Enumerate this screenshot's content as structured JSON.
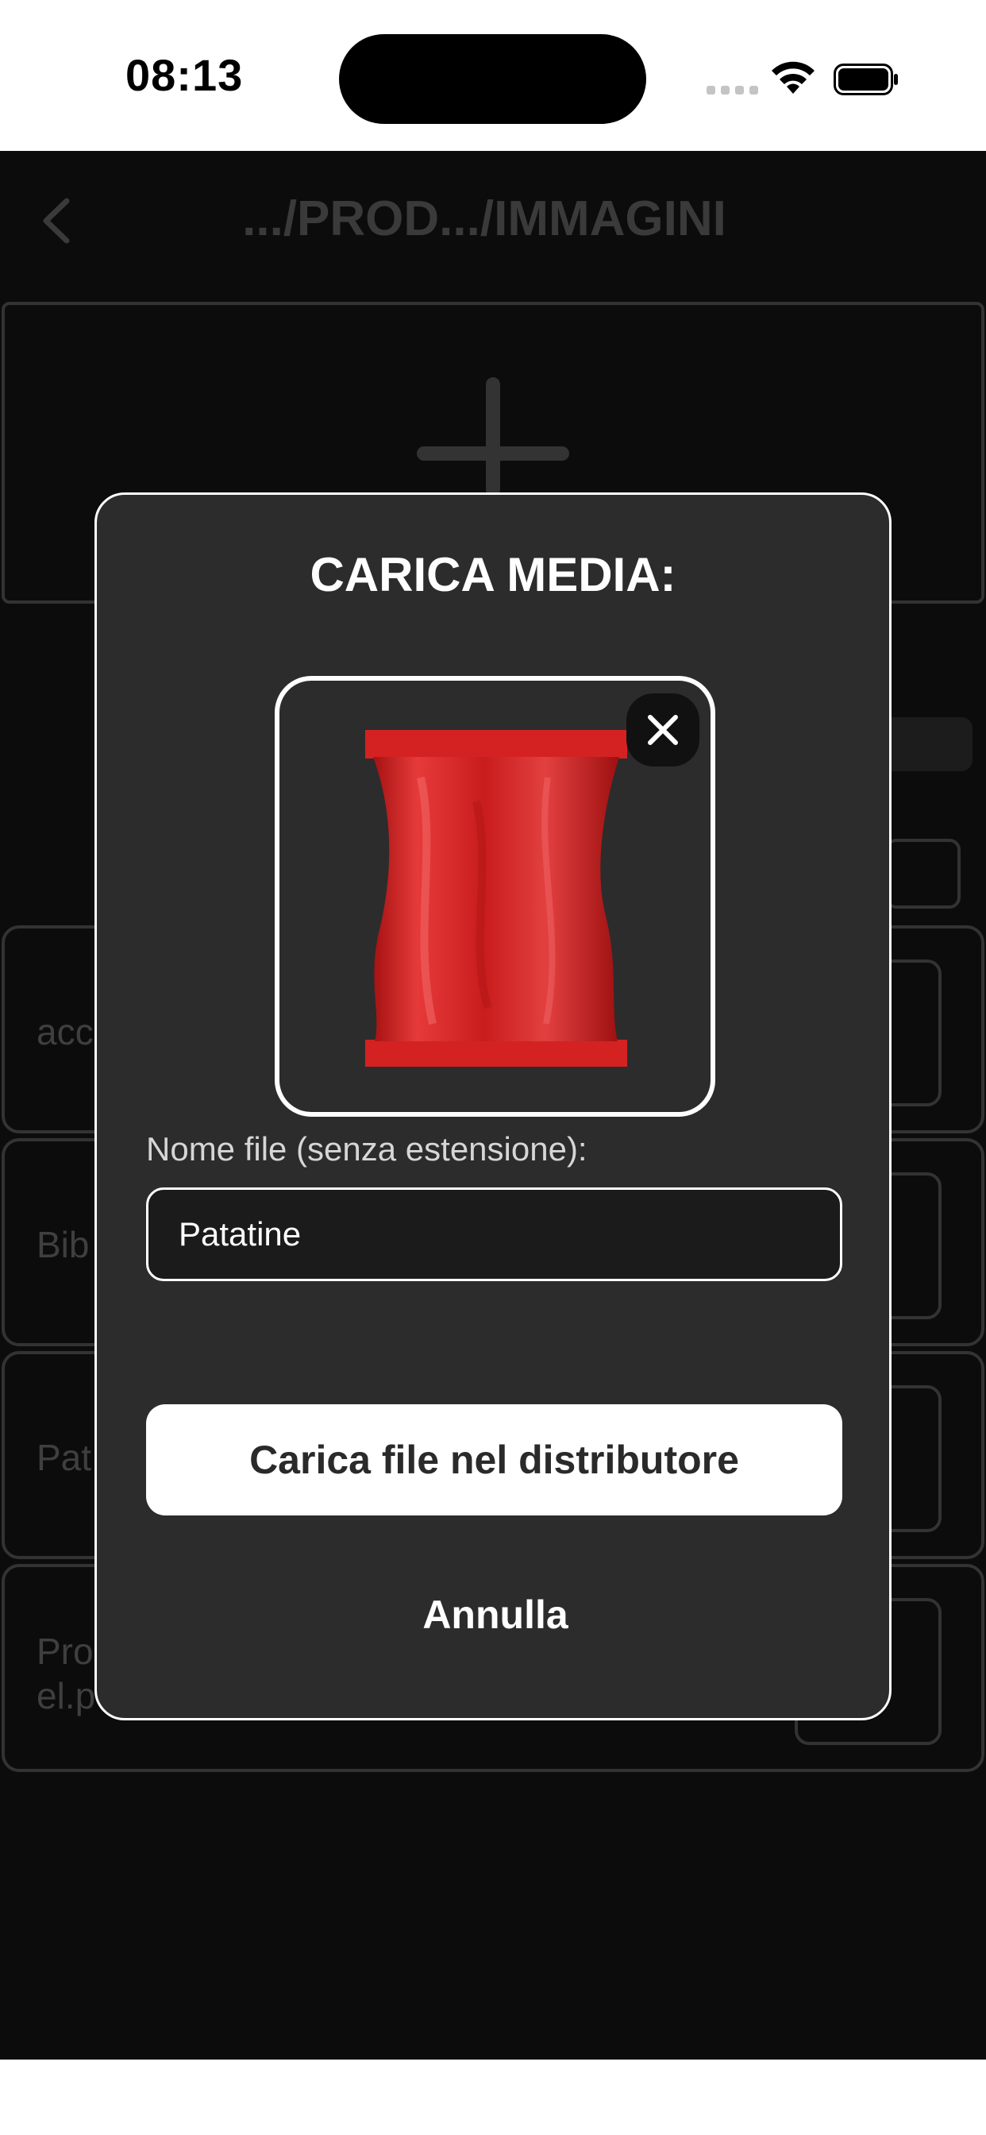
{
  "status_bar": {
    "time": "08:13",
    "icons": [
      "cellular-signal-icon",
      "wifi-icon",
      "battery-icon"
    ]
  },
  "nav": {
    "back_icon": "chevron-left-icon",
    "title": ".../PROD.../IMMAGINI"
  },
  "background": {
    "add_icon": "plus-icon",
    "rows": [
      {
        "label": "acc"
      },
      {
        "label": "Bib"
      },
      {
        "label": "Pat"
      },
      {
        "label": "Pro\nel.p"
      }
    ]
  },
  "modal": {
    "title": "CARICA MEDIA:",
    "preview_icon": "red-snack-bag-image",
    "close_icon": "close-icon",
    "field_label": "Nome file (senza estensione):",
    "field_value": "Patatine",
    "upload_label": "Carica file nel distributore",
    "cancel_label": "Annulla"
  },
  "colors": {
    "modal_bg": "#2c2c2d",
    "app_bg": "#0c0c0c",
    "bag_red": "#d42222",
    "primary_button": "#ffffff"
  }
}
